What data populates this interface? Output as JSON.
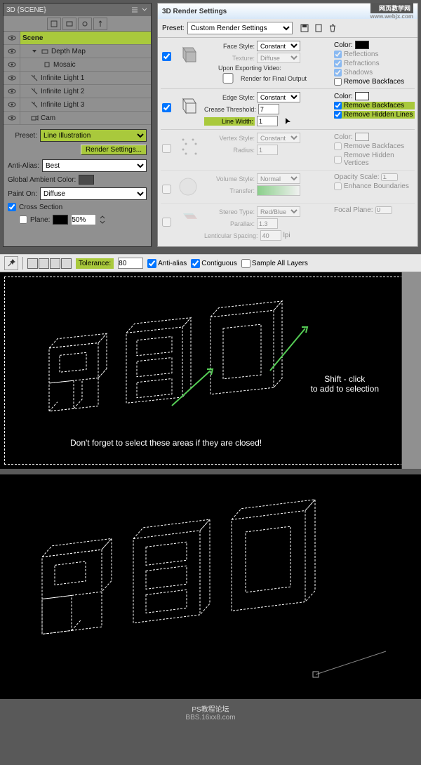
{
  "panel3d": {
    "title": "3D {SCENE}",
    "scene_label": "Scene",
    "items": [
      {
        "label": "Depth Map",
        "icon": "triangle"
      },
      {
        "label": "Mosaic",
        "icon": "box",
        "indent": 2
      },
      {
        "label": "Infinite Light 1",
        "icon": "light"
      },
      {
        "label": "Infinite Light 2",
        "icon": "light"
      },
      {
        "label": "Infinite Light 3",
        "icon": "light"
      },
      {
        "label": "Cam",
        "icon": "cam"
      }
    ],
    "preset_label": "Preset:",
    "preset_value": "Line Illustration",
    "render_btn": "Render Settings...",
    "aa_label": "Anti-Alias:",
    "aa_value": "Best",
    "gac_label": "Global Ambient Color:",
    "painton_label": "Paint On:",
    "painton_value": "Diffuse",
    "cross_section": "Cross Section",
    "plane_label": "Plane:",
    "plane_value": "50%"
  },
  "render": {
    "title": "3D Render Settings",
    "website": "网页教学网",
    "website_url": "www.webjx.com",
    "preset_label": "Preset:",
    "preset_value": "Custom Render Settings",
    "face": {
      "label": "Face Style:",
      "value": "Constant",
      "texture_label": "Texture:",
      "texture_value": "Diffuse",
      "export_label": "Upon Exporting Video:",
      "render_final": "Render for Final Output",
      "color_label": "Color:",
      "reflections": "Reflections",
      "refractions": "Refractions",
      "shadows": "Shadows",
      "remove_bf": "Remove Backfaces"
    },
    "edge": {
      "label": "Edge Style:",
      "value": "Constant",
      "crease_label": "Crease Threshold:",
      "crease_value": "7",
      "linewidth_label": "Line Width:",
      "linewidth_value": "1",
      "color_label": "Color:",
      "remove_bf": "Remove Backfaces",
      "remove_hl": "Remove Hidden Lines"
    },
    "vertex": {
      "label": "Vertex Style:",
      "value": "Constant",
      "radius_label": "Radius:",
      "radius_value": "1",
      "color_label": "Color:",
      "remove_bf": "Remove Backfaces",
      "remove_hv": "Remove Hidden Vertices"
    },
    "volume": {
      "label": "Volume Style:",
      "value": "Normal",
      "transfer_label": "Transfer:",
      "opacity_label": "Opacity Scale:",
      "opacity_value": "1",
      "enhance": "Enhance Boundaries"
    },
    "stereo": {
      "label": "Stereo Type:",
      "value": "Red/Blue",
      "parallax_label": "Parallax:",
      "parallax_value": "1.3",
      "lent_label": "Lenticular Spacing:",
      "lent_value": "40",
      "lpi": "lpi",
      "focal_label": "Focal Plane:",
      "focal_value": "0"
    }
  },
  "options": {
    "tolerance_label": "Tolerance:",
    "tolerance_value": "80",
    "antialias": "Anti-alias",
    "contiguous": "Contiguous",
    "sample_all": "Sample All Layers"
  },
  "annotations": {
    "shift_click": "Shift - click\nto add to selection",
    "dont_forget": "Don't forget to select these areas if they are closed!"
  },
  "footer": {
    "line1": "PS教程论坛",
    "line2": "BBS.16xx8.com"
  }
}
